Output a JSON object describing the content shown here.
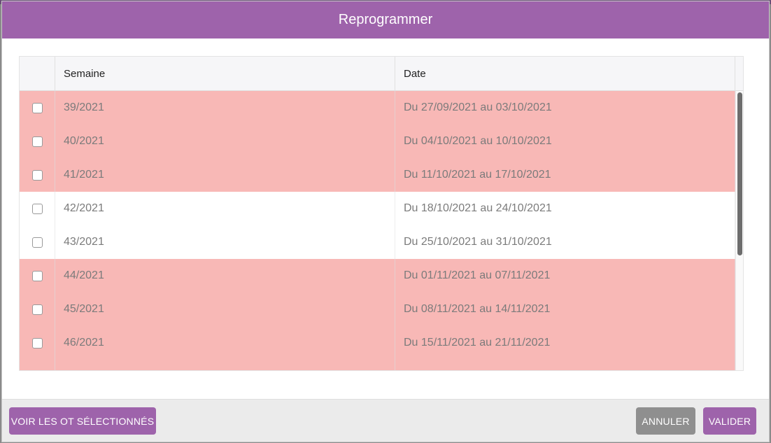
{
  "dialog": {
    "title": "Reprogrammer"
  },
  "table": {
    "columns": [
      "",
      "Semaine",
      "Date"
    ],
    "rows": [
      {
        "week": "39/2021",
        "date": "Du 27/09/2021 au 03/10/2021",
        "highlighted": true,
        "checked": false
      },
      {
        "week": "40/2021",
        "date": "Du 04/10/2021 au 10/10/2021",
        "highlighted": true,
        "checked": false
      },
      {
        "week": "41/2021",
        "date": "Du 11/10/2021 au 17/10/2021",
        "highlighted": true,
        "checked": false
      },
      {
        "week": "42/2021",
        "date": "Du 18/10/2021 au 24/10/2021",
        "highlighted": false,
        "checked": false
      },
      {
        "week": "43/2021",
        "date": "Du 25/10/2021 au 31/10/2021",
        "highlighted": false,
        "checked": false
      },
      {
        "week": "44/2021",
        "date": "Du 01/11/2021 au 07/11/2021",
        "highlighted": true,
        "checked": false
      },
      {
        "week": "45/2021",
        "date": "Du 08/11/2021 au 14/11/2021",
        "highlighted": true,
        "checked": false
      },
      {
        "week": "46/2021",
        "date": "Du 15/11/2021 au 21/11/2021",
        "highlighted": true,
        "checked": false
      },
      {
        "week": "",
        "date": "",
        "highlighted": true,
        "checked": false
      }
    ]
  },
  "footer": {
    "view_selected_label": "VOIR LES OT SÉLECTIONNÉS",
    "cancel_label": "ANNULER",
    "validate_label": "VALIDER"
  },
  "colors": {
    "accent": "#9e63ab",
    "row_highlight": "#f8b8b6",
    "secondary_button": "#8f8f8f"
  }
}
